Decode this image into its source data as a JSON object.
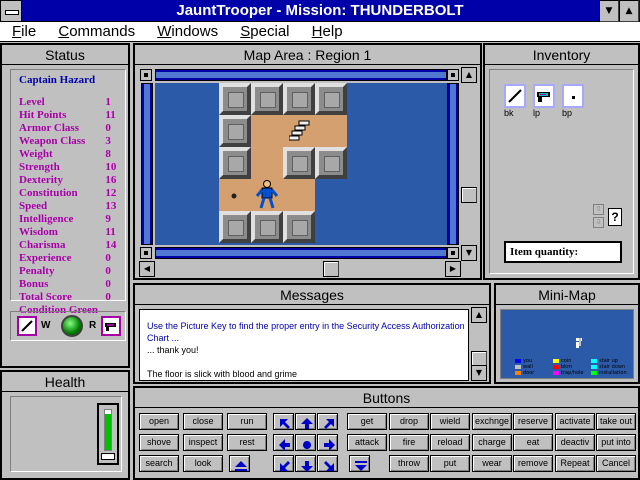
{
  "window": {
    "title": "JauntTrooper - Mission: THUNDERBOLT",
    "minimize_glyph": "▼",
    "maximize_glyph": "▲"
  },
  "menu": [
    "File",
    "Commands",
    "Windows",
    "Special",
    "Help"
  ],
  "status": {
    "title": "Status",
    "character_name": "Captain Hazard",
    "stats": [
      {
        "label": "Level",
        "value": "1"
      },
      {
        "label": "Hit Points",
        "value": "11"
      },
      {
        "label": "Armor Class",
        "value": "0"
      },
      {
        "label": "Weapon Class",
        "value": "3"
      },
      {
        "label": "Weight",
        "value": "8"
      },
      {
        "label": "Strength",
        "value": "10"
      },
      {
        "label": "Dexterity",
        "value": "16"
      },
      {
        "label": "Constitution",
        "value": "12"
      },
      {
        "label": "Speed",
        "value": "13"
      },
      {
        "label": "Intelligence",
        "value": "9"
      },
      {
        "label": "Wisdom",
        "value": "11"
      },
      {
        "label": "Charisma",
        "value": "14"
      },
      {
        "label": "Experience",
        "value": "0"
      },
      {
        "label": "Penalty",
        "value": "0"
      },
      {
        "label": "Bonus",
        "value": "0"
      },
      {
        "label": "Total Score",
        "value": "0"
      }
    ],
    "condition": "Condition Green",
    "weapon_label": "W",
    "ranged_label": "R"
  },
  "health": {
    "title": "Health",
    "level_fraction": 0.9
  },
  "map": {
    "title": "Map Area : Region 1"
  },
  "messages": {
    "title": "Messages",
    "lines": [
      "Use the Picture Key to find the proper entry in the Security Access Authorization",
      "Chart ...",
      "... thank you!",
      "",
      "The floor is slick with blood and grime"
    ]
  },
  "inventory": {
    "title": "Inventory",
    "items": [
      {
        "label": "bk",
        "icon": "baton-icon"
      },
      {
        "label": "lp",
        "icon": "laser-pistol-icon"
      },
      {
        "label": "bp",
        "icon": "bomb-pack-icon"
      }
    ],
    "help_glyph": "?",
    "up_glyph": "⇧",
    "down_glyph": "⇩",
    "item_quantity_label": "Item quantity:"
  },
  "minimap": {
    "title": "Mini-Map",
    "legend": [
      {
        "label": "you",
        "color": "#0000ff"
      },
      {
        "label": "coin",
        "color": "#ffff00"
      },
      {
        "label": "stair up",
        "color": "#00ffff"
      },
      {
        "label": "wall",
        "color": "#c0c0c0"
      },
      {
        "label": "bkm",
        "color": "#ff0000"
      },
      {
        "label": "stair down",
        "color": "#00ffff"
      },
      {
        "label": "door",
        "color": "#ff8000"
      },
      {
        "label": "trap/hole",
        "color": "#ff00ff"
      },
      {
        "label": "installation",
        "color": "#00ff00"
      }
    ]
  },
  "buttons": {
    "title": "Buttons",
    "rows": [
      [
        "open",
        "close",
        "run",
        "get",
        "drop",
        "wield",
        "exchnge",
        "reserve",
        "activate",
        "take out"
      ],
      [
        "shove",
        "inspect",
        "rest",
        "attack",
        "fire",
        "reload",
        "charge",
        "eat",
        "deactiv",
        "put into"
      ],
      [
        "search",
        "look",
        "throw",
        "put",
        "wear",
        "remove",
        "Repeat",
        "Cancel"
      ]
    ],
    "direction_icons": [
      [
        "arrow-up-left-icon",
        "arrow-up-icon",
        "arrow-up-right-icon"
      ],
      [
        "arrow-left-icon",
        "center-dot-icon",
        "arrow-right-icon"
      ],
      [
        "arrow-down-left-icon",
        "arrow-down-icon",
        "arrow-down-right-icon"
      ]
    ],
    "stair_up_icon": "stair-up-icon",
    "stair_down_icon": "stair-down-icon"
  },
  "colors": {
    "title_bar": "#0000a8",
    "stat_text": "#a800a8",
    "name_text": "#0000a8",
    "map_water": "#2a5aa8",
    "map_floor": "#d4a070",
    "health_green": "#00c000"
  }
}
